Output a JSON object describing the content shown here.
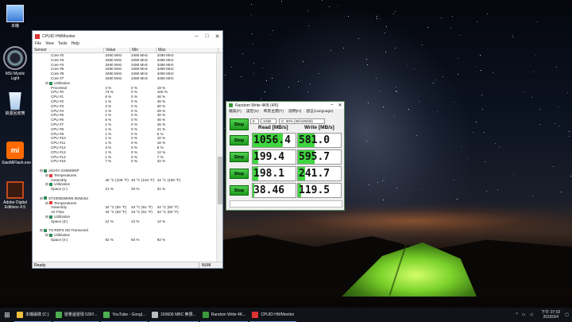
{
  "desktop": {
    "icons": [
      {
        "label": "本機",
        "icon": "computer-icon"
      },
      {
        "label": "MSI Mystic Light",
        "icon": "mystic-light-icon"
      },
      {
        "label": "資源回收筒",
        "icon": "recycle-bin-icon"
      },
      {
        "label": "XiaoMiFlash.exe",
        "icon": "mi-icon"
      },
      {
        "label": "Adobe Digital Editions 4.5",
        "icon": "adobe-de-icon"
      }
    ]
  },
  "hwmonitor": {
    "title": "CPUID HWMonitor",
    "menu": [
      "File",
      "View",
      "Tools",
      "Help"
    ],
    "columns": [
      "Sensor",
      "Value",
      "Min",
      "Max"
    ],
    "rows": [
      {
        "indent": 3,
        "name": "Core #2",
        "value": "3490 MHz",
        "min": "3490 MHz",
        "max": "3490 MHz"
      },
      {
        "indent": 3,
        "name": "Core #3",
        "value": "3490 MHz",
        "min": "3490 MHz",
        "max": "3490 MHz"
      },
      {
        "indent": 3,
        "name": "Core #4",
        "value": "3490 MHz",
        "min": "3490 MHz",
        "max": "3490 MHz"
      },
      {
        "indent": 3,
        "name": "Core #5",
        "value": "3490 MHz",
        "min": "3490 MHz",
        "max": "3490 MHz"
      },
      {
        "indent": 3,
        "name": "Core #6",
        "value": "3490 MHz",
        "min": "3490 MHz",
        "max": "3490 MHz"
      },
      {
        "indent": 3,
        "name": "Core #7",
        "value": "3490 MHz",
        "min": "3490 MHz",
        "max": "3490 MHz"
      },
      {
        "indent": 2,
        "name": "Utilization",
        "value": "",
        "min": "",
        "max": "",
        "group": true
      },
      {
        "indent": 3,
        "name": "Processor",
        "value": "4 %",
        "min": "0 %",
        "max": "19 %"
      },
      {
        "indent": 3,
        "name": "CPU #0",
        "value": "73 %",
        "min": "0 %",
        "max": "100 %"
      },
      {
        "indent": 3,
        "name": "CPU #1",
        "value": "6 %",
        "min": "0 %",
        "max": "46 %"
      },
      {
        "indent": 3,
        "name": "CPU #2",
        "value": "1 %",
        "min": "0 %",
        "max": "46 %"
      },
      {
        "indent": 3,
        "name": "CPU #3",
        "value": "3 %",
        "min": "0 %",
        "max": "30 %"
      },
      {
        "indent": 3,
        "name": "CPU #4",
        "value": "1 %",
        "min": "0 %",
        "max": "29 %"
      },
      {
        "indent": 3,
        "name": "CPU #5",
        "value": "1 %",
        "min": "0 %",
        "max": "40 %"
      },
      {
        "indent": 3,
        "name": "CPU #6",
        "value": "6 %",
        "min": "0 %",
        "max": "46 %"
      },
      {
        "indent": 3,
        "name": "CPU #7",
        "value": "1 %",
        "min": "0 %",
        "max": "45 %"
      },
      {
        "indent": 3,
        "name": "CPU #8",
        "value": "1 %",
        "min": "0 %",
        "max": "21 %"
      },
      {
        "indent": 3,
        "name": "CPU #9",
        "value": "1 %",
        "min": "0 %",
        "max": "6 %"
      },
      {
        "indent": 3,
        "name": "CPU #10",
        "value": "1 %",
        "min": "0 %",
        "max": "10 %"
      },
      {
        "indent": 3,
        "name": "CPU #11",
        "value": "1 %",
        "min": "0 %",
        "max": "18 %"
      },
      {
        "indent": 3,
        "name": "CPU #12",
        "value": "3 %",
        "min": "0 %",
        "max": "8 %"
      },
      {
        "indent": 3,
        "name": "CPU #13",
        "value": "1 %",
        "min": "0 %",
        "max": "12 %"
      },
      {
        "indent": 3,
        "name": "CPU #14",
        "value": "1 %",
        "min": "0 %",
        "max": "7 %"
      },
      {
        "indent": 3,
        "name": "CPU #15",
        "value": "7 %",
        "min": "0 %",
        "max": "42 %"
      },
      {
        "indent": 0,
        "name": "",
        "value": "",
        "min": "",
        "max": ""
      },
      {
        "indent": 1,
        "name": "ADATA SX8000NP",
        "value": "",
        "min": "",
        "max": "",
        "group": true
      },
      {
        "indent": 2,
        "name": "Temperatures",
        "value": "",
        "min": "",
        "max": "",
        "group": true
      },
      {
        "indent": 3,
        "name": "Assembly",
        "value": "40 °C (109 °F)",
        "min": "40 °C (104 °F)",
        "max": "43 °C (109 °F)"
      },
      {
        "indent": 2,
        "name": "Utilization",
        "value": "",
        "min": "",
        "max": "",
        "group": true
      },
      {
        "indent": 3,
        "name": "Space (c:)",
        "value": "21 %",
        "min": "30 %",
        "max": "31 %"
      },
      {
        "indent": 0,
        "name": "",
        "value": "",
        "min": "",
        "max": ""
      },
      {
        "indent": 1,
        "name": "ST2000DM006-2DM164",
        "value": "",
        "min": "",
        "max": "",
        "group": true
      },
      {
        "indent": 2,
        "name": "Temperatures",
        "value": "",
        "min": "",
        "max": "",
        "group": true
      },
      {
        "indent": 3,
        "name": "Assembly",
        "value": "34 °C (93 °F)",
        "min": "33 °C (91 °F)",
        "max": "34 °C (93 °F)"
      },
      {
        "indent": 3,
        "name": "Air Flow",
        "value": "34 °C (93 °F)",
        "min": "33 °C (91 °F)",
        "max": "34 °C (93 °F)"
      },
      {
        "indent": 2,
        "name": "Utilization",
        "value": "",
        "min": "",
        "max": "",
        "group": true
      },
      {
        "indent": 3,
        "name": "Space (d:)",
        "value": "12 %",
        "min": "12 %",
        "max": "12 %"
      },
      {
        "indent": 0,
        "name": "",
        "value": "",
        "min": "",
        "max": ""
      },
      {
        "indent": 1,
        "name": "TS-RDF5 SD  Transcend",
        "value": "",
        "min": "",
        "max": "",
        "group": true
      },
      {
        "indent": 2,
        "name": "Utilization",
        "value": "",
        "min": "",
        "max": "",
        "group": true
      },
      {
        "indent": 3,
        "name": "Space (e:)",
        "value": "92 %",
        "min": "92 %",
        "max": "92 %"
      }
    ],
    "status_left": "Ready",
    "status_right": "NUM"
  },
  "random_write": {
    "title": "Random Write 4KB (4/5)",
    "menu": [
      "檔案(F)",
      "設定(S)",
      "佈景主題(T)",
      "說明(H)",
      "語言(Language)"
    ],
    "count_value": "5",
    "size_value": "1GiB",
    "drive_value": "C: 30% (36/119GiB)",
    "read_header": "Read [MB/s]",
    "write_header": "Write [MB/s]",
    "stop_label": "Stop",
    "results": [
      {
        "read": "1056.4",
        "write": "581.0",
        "read_fill": 0.7,
        "write_fill": 0.38
      },
      {
        "read": "199.4",
        "write": "595.7",
        "read_fill": 0.13,
        "write_fill": 0.39
      },
      {
        "read": "198.1",
        "write": "241.7",
        "read_fill": 0.13,
        "write_fill": 0.16
      },
      {
        "read": "38.46",
        "write": "119.5",
        "read_fill": 0.03,
        "write_fill": 0.08
      }
    ]
  },
  "taskbar": {
    "start_icon": "windows-start-icon",
    "items": [
      {
        "label": "本機磁碟 (C:)",
        "color": "#f0c040"
      },
      {
        "label": "發覺還發現 539!!...",
        "color": "#4caf50"
      },
      {
        "label": "YouTube - Googl...",
        "color": "#4caf50"
      },
      {
        "label": "150606 MBC 無限...",
        "color": "#bbb"
      },
      {
        "label": "Random Write 4K...",
        "color": "#3a9a3a"
      },
      {
        "label": "CPUID HWMonitor",
        "color": "#d33"
      }
    ],
    "time": "下午 07:02",
    "date": "2018/3/4"
  }
}
